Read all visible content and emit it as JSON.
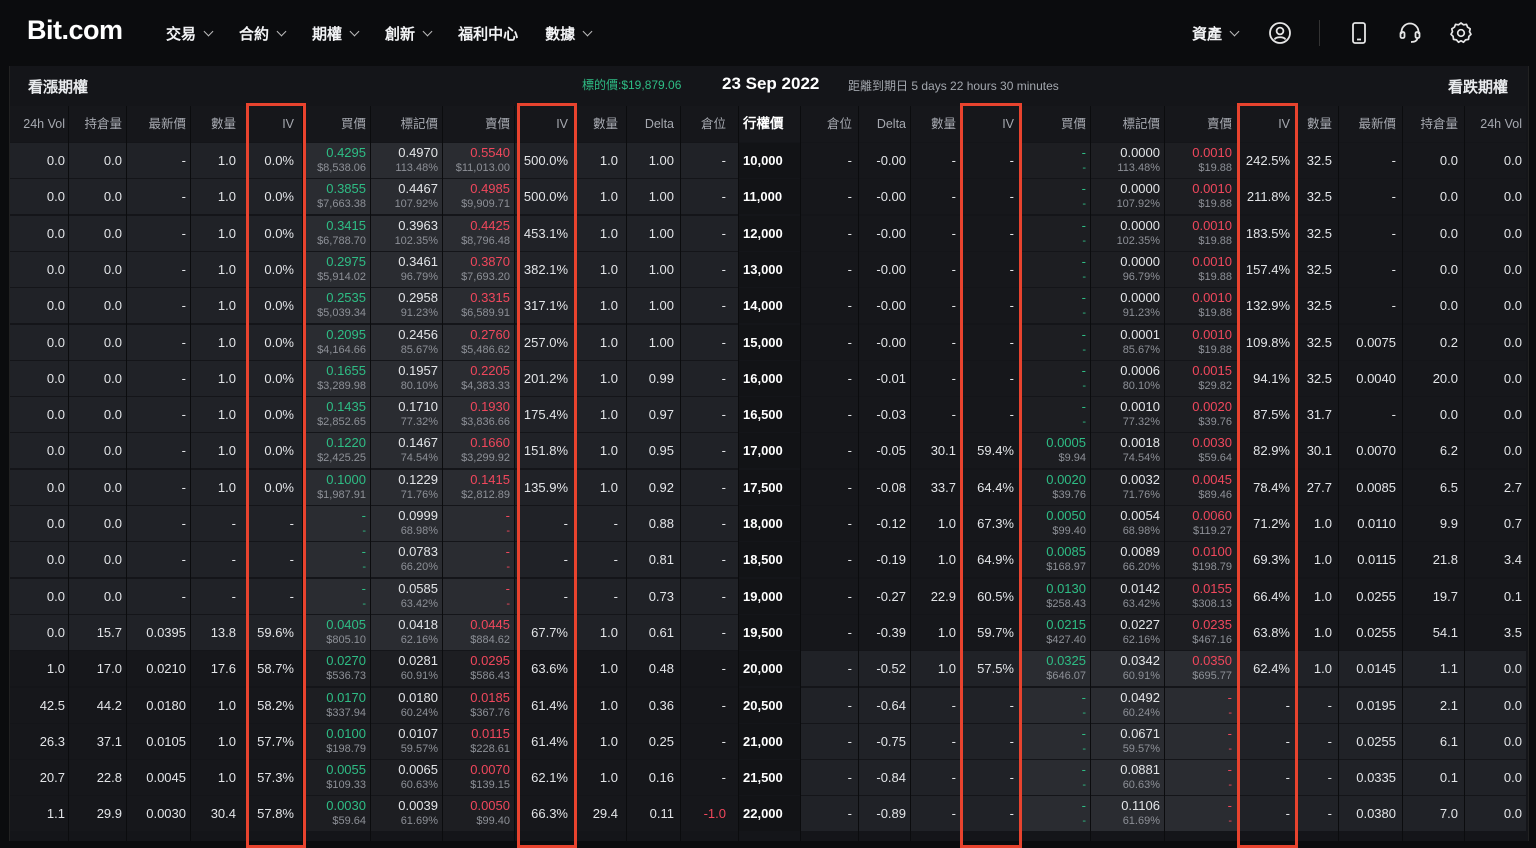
{
  "nav": {
    "logo": "Bit.com",
    "items": [
      "交易",
      "合約",
      "期權",
      "創新",
      "福利中心",
      "數據"
    ],
    "items_chevron": [
      true,
      true,
      true,
      true,
      false,
      true
    ],
    "assets_label": "資產"
  },
  "panel": {
    "calls_title": "看漲期權",
    "puts_title": "看跌期權",
    "underlying_price": "標的價:$19,879.06",
    "expiry": "23 Sep 2022",
    "countdown": "距離到期日 5 days 22 hours 30 minutes"
  },
  "columns": [
    "24h Vol",
    "持倉量",
    "最新價",
    "數量",
    "IV",
    "買價",
    "標記價",
    "賣價",
    "IV",
    "數量",
    "Delta",
    "倉位",
    "行權價",
    "倉位",
    "Delta",
    "數量",
    "IV",
    "買價",
    "標記價",
    "賣價",
    "IV",
    "數量",
    "最新價",
    "持倉量",
    "24h Vol"
  ],
  "rows": [
    {
      "itm": "call",
      "c": [
        "0.0",
        "0.0",
        "-",
        "1.0",
        "0.0%",
        [
          "0.4295",
          "$8,538.06"
        ],
        [
          "0.4970",
          "113.48%"
        ],
        [
          "0.5540",
          "$11,013.00"
        ],
        "500.0%",
        "1.0",
        "1.00",
        "-"
      ],
      "k": "10,000",
      "p": [
        "-",
        "-0.00",
        "-",
        "-",
        [
          "-",
          "-"
        ],
        [
          "0.0000",
          "113.48%"
        ],
        [
          "0.0010",
          "$19.88"
        ],
        "242.5%",
        "32.5",
        "-",
        "0.0",
        "0.0"
      ]
    },
    {
      "itm": "call",
      "c": [
        "0.0",
        "0.0",
        "-",
        "1.0",
        "0.0%",
        [
          "0.3855",
          "$7,663.38"
        ],
        [
          "0.4467",
          "107.92%"
        ],
        [
          "0.4985",
          "$9,909.71"
        ],
        "500.0%",
        "1.0",
        "1.00",
        "-"
      ],
      "k": "11,000",
      "p": [
        "-",
        "-0.00",
        "-",
        "-",
        [
          "-",
          "-"
        ],
        [
          "0.0000",
          "107.92%"
        ],
        [
          "0.0010",
          "$19.88"
        ],
        "211.8%",
        "32.5",
        "-",
        "0.0",
        "0.0"
      ]
    },
    {
      "itm": "call",
      "c": [
        "0.0",
        "0.0",
        "-",
        "1.0",
        "0.0%",
        [
          "0.3415",
          "$6,788.70"
        ],
        [
          "0.3963",
          "102.35%"
        ],
        [
          "0.4425",
          "$8,796.48"
        ],
        "453.1%",
        "1.0",
        "1.00",
        "-"
      ],
      "k": "12,000",
      "p": [
        "-",
        "-0.00",
        "-",
        "-",
        [
          "-",
          "-"
        ],
        [
          "0.0000",
          "102.35%"
        ],
        [
          "0.0010",
          "$19.88"
        ],
        "183.5%",
        "32.5",
        "-",
        "0.0",
        "0.0"
      ]
    },
    {
      "itm": "call",
      "c": [
        "0.0",
        "0.0",
        "-",
        "1.0",
        "0.0%",
        [
          "0.2975",
          "$5,914.02"
        ],
        [
          "0.3461",
          "96.79%"
        ],
        [
          "0.3870",
          "$7,693.20"
        ],
        "382.1%",
        "1.0",
        "1.00",
        "-"
      ],
      "k": "13,000",
      "p": [
        "-",
        "-0.00",
        "-",
        "-",
        [
          "-",
          "-"
        ],
        [
          "0.0000",
          "96.79%"
        ],
        [
          "0.0010",
          "$19.88"
        ],
        "157.4%",
        "32.5",
        "-",
        "0.0",
        "0.0"
      ]
    },
    {
      "itm": "call",
      "c": [
        "0.0",
        "0.0",
        "-",
        "1.0",
        "0.0%",
        [
          "0.2535",
          "$5,039.34"
        ],
        [
          "0.2958",
          "91.23%"
        ],
        [
          "0.3315",
          "$6,589.91"
        ],
        "317.1%",
        "1.0",
        "1.00",
        "-"
      ],
      "k": "14,000",
      "p": [
        "-",
        "-0.00",
        "-",
        "-",
        [
          "-",
          "-"
        ],
        [
          "0.0000",
          "91.23%"
        ],
        [
          "0.0010",
          "$19.88"
        ],
        "132.9%",
        "32.5",
        "-",
        "0.0",
        "0.0"
      ]
    },
    {
      "itm": "call",
      "c": [
        "0.0",
        "0.0",
        "-",
        "1.0",
        "0.0%",
        [
          "0.2095",
          "$4,164.66"
        ],
        [
          "0.2456",
          "85.67%"
        ],
        [
          "0.2760",
          "$5,486.62"
        ],
        "257.0%",
        "1.0",
        "1.00",
        "-"
      ],
      "k": "15,000",
      "p": [
        "-",
        "-0.00",
        "-",
        "-",
        [
          "-",
          "-"
        ],
        [
          "0.0001",
          "85.67%"
        ],
        [
          "0.0010",
          "$19.88"
        ],
        "109.8%",
        "32.5",
        "0.0075",
        "0.2",
        "0.0"
      ]
    },
    {
      "itm": "call",
      "c": [
        "0.0",
        "0.0",
        "-",
        "1.0",
        "0.0%",
        [
          "0.1655",
          "$3,289.98"
        ],
        [
          "0.1957",
          "80.10%"
        ],
        [
          "0.2205",
          "$4,383.33"
        ],
        "201.2%",
        "1.0",
        "0.99",
        "-"
      ],
      "k": "16,000",
      "p": [
        "-",
        "-0.01",
        "-",
        "-",
        [
          "-",
          "-"
        ],
        [
          "0.0006",
          "80.10%"
        ],
        [
          "0.0015",
          "$29.82"
        ],
        "94.1%",
        "32.5",
        "0.0040",
        "20.0",
        "0.0"
      ]
    },
    {
      "itm": "call",
      "c": [
        "0.0",
        "0.0",
        "-",
        "1.0",
        "0.0%",
        [
          "0.1435",
          "$2,852.65"
        ],
        [
          "0.1710",
          "77.32%"
        ],
        [
          "0.1930",
          "$3,836.66"
        ],
        "175.4%",
        "1.0",
        "0.97",
        "-"
      ],
      "k": "16,500",
      "p": [
        "-",
        "-0.03",
        "-",
        "-",
        [
          "-",
          "-"
        ],
        [
          "0.0010",
          "77.32%"
        ],
        [
          "0.0020",
          "$39.76"
        ],
        "87.5%",
        "31.7",
        "-",
        "0.0",
        "0.0"
      ]
    },
    {
      "itm": "call",
      "c": [
        "0.0",
        "0.0",
        "-",
        "1.0",
        "0.0%",
        [
          "0.1220",
          "$2,425.25"
        ],
        [
          "0.1467",
          "74.54%"
        ],
        [
          "0.1660",
          "$3,299.92"
        ],
        "151.8%",
        "1.0",
        "0.95",
        "-"
      ],
      "k": "17,000",
      "p": [
        "-",
        "-0.05",
        "30.1",
        "59.4%",
        [
          "0.0005",
          "$9.94"
        ],
        [
          "0.0018",
          "74.54%"
        ],
        [
          "0.0030",
          "$59.64"
        ],
        "82.9%",
        "30.1",
        "0.0070",
        "6.2",
        "0.0"
      ]
    },
    {
      "itm": "call",
      "c": [
        "0.0",
        "0.0",
        "-",
        "1.0",
        "0.0%",
        [
          "0.1000",
          "$1,987.91"
        ],
        [
          "0.1229",
          "71.76%"
        ],
        [
          "0.1415",
          "$2,812.89"
        ],
        "135.9%",
        "1.0",
        "0.92",
        "-"
      ],
      "k": "17,500",
      "p": [
        "-",
        "-0.08",
        "33.7",
        "64.4%",
        [
          "0.0020",
          "$39.76"
        ],
        [
          "0.0032",
          "71.76%"
        ],
        [
          "0.0045",
          "$89.46"
        ],
        "78.4%",
        "27.7",
        "0.0085",
        "6.5",
        "2.7"
      ]
    },
    {
      "itm": "call",
      "c": [
        "0.0",
        "0.0",
        "-",
        "-",
        "-",
        [
          "-",
          "-"
        ],
        [
          "0.0999",
          "68.98%"
        ],
        [
          "-",
          "-"
        ],
        "-",
        "-",
        "0.88",
        "-"
      ],
      "k": "18,000",
      "p": [
        "-",
        "-0.12",
        "1.0",
        "67.3%",
        [
          "0.0050",
          "$99.40"
        ],
        [
          "0.0054",
          "68.98%"
        ],
        [
          "0.0060",
          "$119.27"
        ],
        "71.2%",
        "1.0",
        "0.0110",
        "9.9",
        "0.7"
      ]
    },
    {
      "itm": "call",
      "c": [
        "0.0",
        "0.0",
        "-",
        "-",
        "-",
        [
          "-",
          "-"
        ],
        [
          "0.0783",
          "66.20%"
        ],
        [
          "-",
          "-"
        ],
        "-",
        "-",
        "0.81",
        "-"
      ],
      "k": "18,500",
      "p": [
        "-",
        "-0.19",
        "1.0",
        "64.9%",
        [
          "0.0085",
          "$168.97"
        ],
        [
          "0.0089",
          "66.20%"
        ],
        [
          "0.0100",
          "$198.79"
        ],
        "69.3%",
        "1.0",
        "0.0115",
        "21.8",
        "3.4"
      ]
    },
    {
      "itm": "call",
      "c": [
        "0.0",
        "0.0",
        "-",
        "-",
        "-",
        [
          "-",
          "-"
        ],
        [
          "0.0585",
          "63.42%"
        ],
        [
          "-",
          "-"
        ],
        "-",
        "-",
        "0.73",
        "-"
      ],
      "k": "19,000",
      "p": [
        "-",
        "-0.27",
        "22.9",
        "60.5%",
        [
          "0.0130",
          "$258.43"
        ],
        [
          "0.0142",
          "63.42%"
        ],
        [
          "0.0155",
          "$308.13"
        ],
        "66.4%",
        "1.0",
        "0.0255",
        "19.7",
        "0.1"
      ]
    },
    {
      "itm": "call",
      "c": [
        "0.0",
        "15.7",
        "0.0395",
        "13.8",
        "59.6%",
        [
          "0.0405",
          "$805.10"
        ],
        [
          "0.0418",
          "62.16%"
        ],
        [
          "0.0445",
          "$884.62"
        ],
        "67.7%",
        "1.0",
        "0.61",
        "-"
      ],
      "k": "19,500",
      "p": [
        "-",
        "-0.39",
        "1.0",
        "59.7%",
        [
          "0.0215",
          "$427.40"
        ],
        [
          "0.0227",
          "62.16%"
        ],
        [
          "0.0235",
          "$467.16"
        ],
        "63.8%",
        "1.0",
        "0.0255",
        "54.1",
        "3.5"
      ]
    },
    {
      "itm": "put",
      "c": [
        "1.0",
        "17.0",
        "0.0210",
        "17.6",
        "58.7%",
        [
          "0.0270",
          "$536.73"
        ],
        [
          "0.0281",
          "60.91%"
        ],
        [
          "0.0295",
          "$586.43"
        ],
        "63.6%",
        "1.0",
        "0.48",
        "-"
      ],
      "k": "20,000",
      "p": [
        "-",
        "-0.52",
        "1.0",
        "57.5%",
        [
          "0.0325",
          "$646.07"
        ],
        [
          "0.0342",
          "60.91%"
        ],
        [
          "0.0350",
          "$695.77"
        ],
        "62.4%",
        "1.0",
        "0.0145",
        "1.1",
        "0.0"
      ]
    },
    {
      "itm": "put",
      "c": [
        "42.5",
        "44.2",
        "0.0180",
        "1.0",
        "58.2%",
        [
          "0.0170",
          "$337.94"
        ],
        [
          "0.0180",
          "60.24%"
        ],
        [
          "0.0185",
          "$367.76"
        ],
        "61.4%",
        "1.0",
        "0.36",
        "-"
      ],
      "k": "20,500",
      "p": [
        "-",
        "-0.64",
        "-",
        "-",
        [
          "-",
          "-"
        ],
        [
          "0.0492",
          "60.24%"
        ],
        [
          "-",
          "-"
        ],
        "-",
        "-",
        "0.0195",
        "2.1",
        "0.0"
      ]
    },
    {
      "itm": "put",
      "c": [
        "26.3",
        "37.1",
        "0.0105",
        "1.0",
        "57.7%",
        [
          "0.0100",
          "$198.79"
        ],
        [
          "0.0107",
          "59.57%"
        ],
        [
          "0.0115",
          "$228.61"
        ],
        "61.4%",
        "1.0",
        "0.25",
        "-"
      ],
      "k": "21,000",
      "p": [
        "-",
        "-0.75",
        "-",
        "-",
        [
          "-",
          "-"
        ],
        [
          "0.0671",
          "59.57%"
        ],
        [
          "-",
          "-"
        ],
        "-",
        "-",
        "0.0255",
        "6.1",
        "0.0"
      ]
    },
    {
      "itm": "put",
      "c": [
        "20.7",
        "22.8",
        "0.0045",
        "1.0",
        "57.3%",
        [
          "0.0055",
          "$109.33"
        ],
        [
          "0.0065",
          "60.63%"
        ],
        [
          "0.0070",
          "$139.15"
        ],
        "62.1%",
        "1.0",
        "0.16",
        "-"
      ],
      "k": "21,500",
      "p": [
        "-",
        "-0.84",
        "-",
        "-",
        [
          "-",
          "-"
        ],
        [
          "0.0881",
          "60.63%"
        ],
        [
          "-",
          "-"
        ],
        "-",
        "-",
        "0.0335",
        "0.1",
        "0.0"
      ]
    },
    {
      "itm": "put",
      "c": [
        "1.1",
        "29.9",
        "0.0030",
        "30.4",
        "57.8%",
        [
          "0.0030",
          "$59.64"
        ],
        [
          "0.0039",
          "61.69%"
        ],
        [
          "0.0050",
          "$99.40"
        ],
        "66.3%",
        "29.4",
        "0.11",
        "-1.0"
      ],
      "k": "22,000",
      "p": [
        "-",
        "-0.89",
        "-",
        "-",
        [
          "-",
          "-"
        ],
        [
          "0.1106",
          "61.69%"
        ],
        [
          "-",
          "-"
        ],
        "-",
        "-",
        "0.0380",
        "7.0",
        "0.0"
      ]
    }
  ],
  "colors": {
    "green": "#2ebd85",
    "red": "#f0475c",
    "highlight": "#e8432e"
  }
}
